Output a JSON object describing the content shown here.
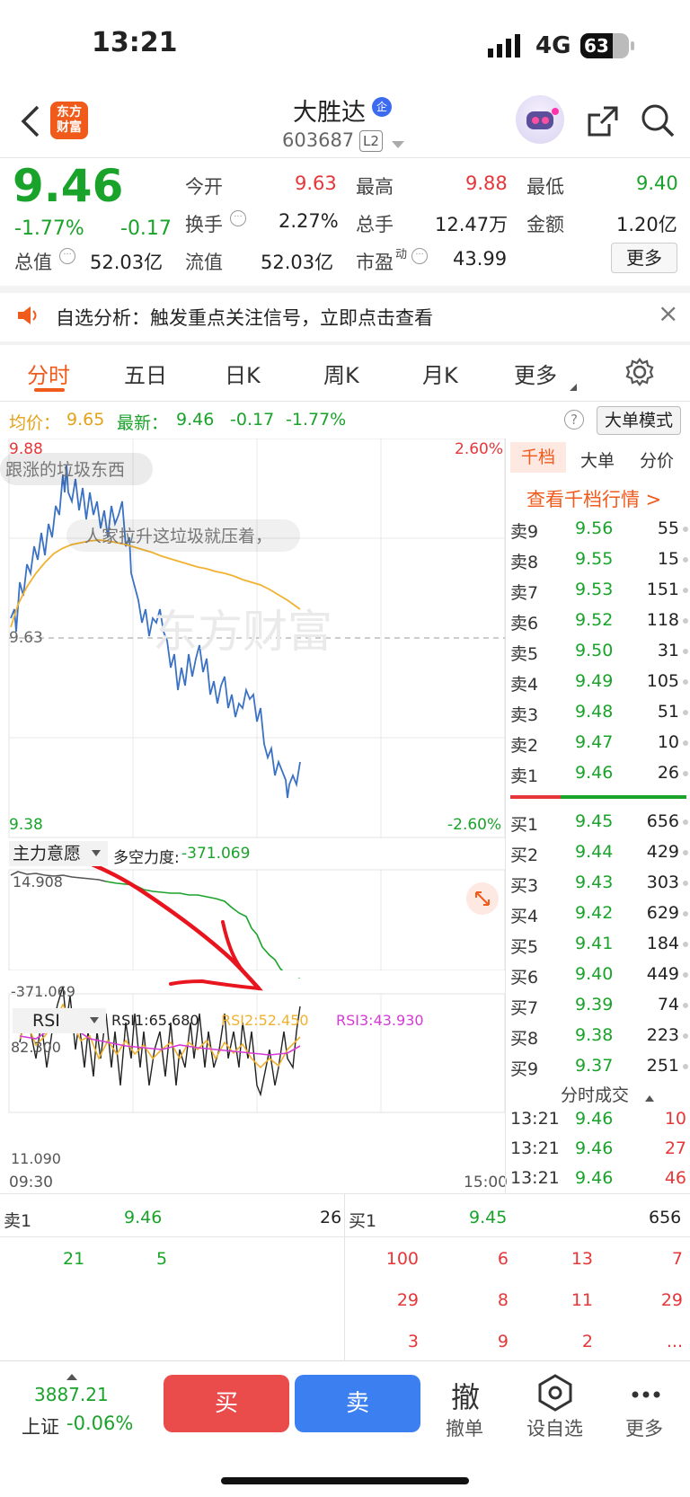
{
  "status_bar": {
    "time": "13:21",
    "network": "4G",
    "battery": "63"
  },
  "header": {
    "logo_text": "东方财富",
    "stock_name": "大胜达",
    "badge": "企",
    "stock_code": "603687",
    "level": "L2"
  },
  "quote": {
    "price": "9.46",
    "change_pct": "-1.77%",
    "change": "-0.17",
    "fields": [
      {
        "label": "今开",
        "value": "9.63"
      },
      {
        "label": "最高",
        "value": "9.88"
      },
      {
        "label": "最低",
        "value": "9.40"
      },
      {
        "label": "换手",
        "value": "2.27%"
      },
      {
        "label": "总手",
        "value": "12.47万"
      },
      {
        "label": "金额",
        "value": "1.20亿"
      },
      {
        "label": "总值",
        "value": "52.03亿"
      },
      {
        "label": "流值",
        "value": "52.03亿"
      },
      {
        "label": "市盈",
        "sup": "动",
        "value": "43.99"
      }
    ],
    "more_button": "更多"
  },
  "notice": {
    "text": "自选分析：触发重点关注信号，立即点击查看",
    "close": "×"
  },
  "tabs": [
    "分时",
    "五日",
    "日K",
    "周K",
    "月K",
    "更多"
  ],
  "chart_header": {
    "avg_label": "均价：",
    "avg_value": "9.65",
    "latest_label": "最新：",
    "latest_value": "9.46",
    "latest_change": "-0.17",
    "latest_pct": "-1.77%",
    "mode_button": "大单模式",
    "help": "?"
  },
  "intraday": {
    "y_top": "9.88",
    "y_mid": "9.63",
    "y_bottom": "9.38",
    "pct_top": "2.60%",
    "pct_bottom": "-2.60%",
    "watermark": "东方财富",
    "danmaku": [
      "跟涨的垃圾东西",
      "人家拉升这垃圾就压着，"
    ],
    "time_start": "09:30",
    "time_end": "15:00"
  },
  "indicator1": {
    "name": "主力意愿",
    "label": "多空力度:",
    "value": "-371.069",
    "top": "14.908",
    "bottom": "-371.069"
  },
  "indicator2": {
    "name": "RSI",
    "rsi1": "RSI1:65.680",
    "rsi2": "RSI2:52.450",
    "rsi3": "RSI3:43.930",
    "top": "82.300",
    "bottom": "11.090"
  },
  "order_book": {
    "tabs": [
      "千档",
      "大单",
      "分价"
    ],
    "link": "查看千档行情 >",
    "asks": [
      {
        "label": "卖9",
        "price": "9.56",
        "vol": "55"
      },
      {
        "label": "卖8",
        "price": "9.55",
        "vol": "15"
      },
      {
        "label": "卖7",
        "price": "9.53",
        "vol": "151"
      },
      {
        "label": "卖6",
        "price": "9.52",
        "vol": "118"
      },
      {
        "label": "卖5",
        "price": "9.50",
        "vol": "31"
      },
      {
        "label": "卖4",
        "price": "9.49",
        "vol": "105"
      },
      {
        "label": "卖3",
        "price": "9.48",
        "vol": "51"
      },
      {
        "label": "卖2",
        "price": "9.47",
        "vol": "10"
      },
      {
        "label": "卖1",
        "price": "9.46",
        "vol": "26"
      }
    ],
    "bids": [
      {
        "label": "买1",
        "price": "9.45",
        "vol": "656"
      },
      {
        "label": "买2",
        "price": "9.44",
        "vol": "429"
      },
      {
        "label": "买3",
        "price": "9.43",
        "vol": "303"
      },
      {
        "label": "买4",
        "price": "9.42",
        "vol": "629"
      },
      {
        "label": "买5",
        "price": "9.41",
        "vol": "184"
      },
      {
        "label": "买6",
        "price": "9.40",
        "vol": "449"
      },
      {
        "label": "买7",
        "price": "9.39",
        "vol": "74"
      },
      {
        "label": "买8",
        "price": "9.38",
        "vol": "223"
      },
      {
        "label": "买9",
        "price": "9.37",
        "vol": "251"
      }
    ],
    "trades_title": "分时成交",
    "trades": [
      {
        "time": "13:21",
        "price": "9.46",
        "vol": "10"
      },
      {
        "time": "13:21",
        "price": "9.46",
        "vol": "27"
      },
      {
        "time": "13:21",
        "price": "9.46",
        "vol": "46"
      }
    ]
  },
  "queue": {
    "sell_label": "卖1",
    "sell_price": "9.46",
    "sell_total": "26",
    "buy_label": "买1",
    "buy_price": "9.45",
    "buy_total": "656",
    "sell_orders": [
      "21",
      "5"
    ],
    "buy_orders": [
      "100",
      "6",
      "13",
      "7",
      "29",
      "8",
      "11",
      "29",
      "3",
      "9",
      "2",
      "..."
    ]
  },
  "bottom_bar": {
    "index_value": "3887.21",
    "index_name": "上证",
    "index_change": "-0.06%",
    "buy": "买",
    "sell": "卖",
    "cancel_icon": "撤",
    "cancel": "撤单",
    "watch": "设自选",
    "more": "更多"
  }
}
